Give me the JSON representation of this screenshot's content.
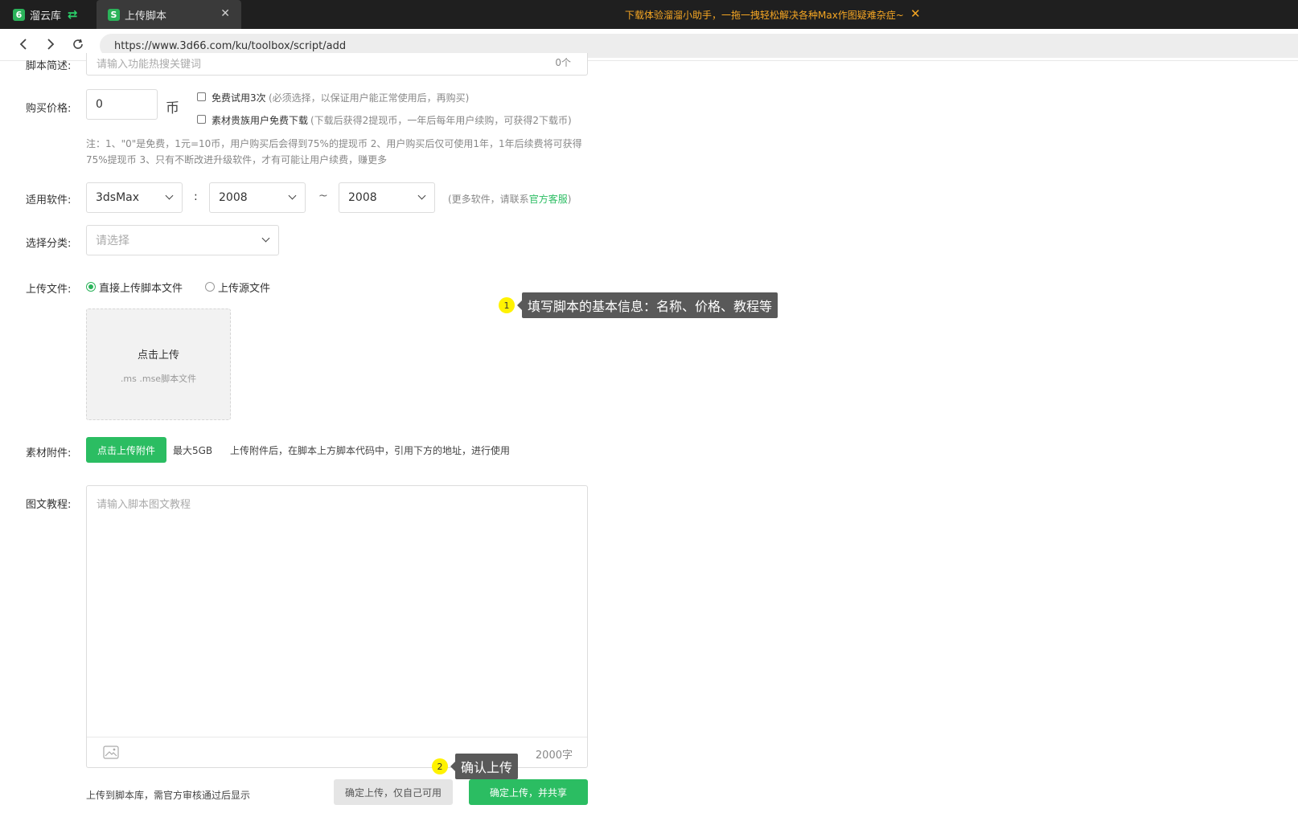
{
  "titlebar": {
    "home_tab": {
      "label": "溜云库",
      "logo": "6"
    },
    "active_tab": {
      "label": "上传脚本",
      "logo": "S"
    },
    "promo_text": "下载体验溜溜小助手，一拖一拽轻松解决各种Max作图疑难杂症~"
  },
  "nav": {
    "url": "https://www.3d66.com/ku/toolbox/script/add"
  },
  "form": {
    "desc": {
      "label": "脚本简述:",
      "placeholder": "请输入功能热搜关键词",
      "count": "0个"
    },
    "price": {
      "label": "购买价格:",
      "value": "0",
      "unit": "币",
      "free_trial": {
        "label": "免费试用3次",
        "note": "(必须选择，以保证用户能正常使用后，再购买)"
      },
      "vip_free": {
        "label": "素材贵族用户免费下载",
        "note": "(下载后获得2提现币，一年后每年用户续购，可获得2下载币)"
      },
      "note_line1": "注：1、\"0\"是免费，1元=10币，用户购买后会得到75%的提现币 2、用户购买后仅可使用1年，1年后续费将可获得",
      "note_line2": "75%提现币 3、只有不断改进升级软件，才有可能让用户续费，赚更多"
    },
    "software": {
      "label": "适用软件:",
      "product": "3dsMax",
      "sep1": ":",
      "from": "2008",
      "sep2": "~",
      "to": "2008",
      "hint_prefix": "(更多软件，请联系",
      "hint_link": "官方客服",
      "hint_suffix": ")"
    },
    "category": {
      "label": "选择分类:",
      "placeholder": "请选择"
    },
    "upload": {
      "label": "上传文件:",
      "option_direct": "直接上传脚本文件",
      "option_source": "上传源文件",
      "box_title": "点击上传",
      "box_hint": ".ms .mse脚本文件"
    },
    "attachment": {
      "label": "素材附件:",
      "button": "点击上传附件",
      "max": "最大5GB",
      "hint": "上传附件后，在脚本上方脚本代码中，引用下方的地址，进行使用"
    },
    "tutorial": {
      "label": "图文教程:",
      "placeholder": "请输入脚本图文教程",
      "limit": "2000字"
    },
    "footer": {
      "notice": "上传到脚本库，需官方审核通过后显示",
      "private_button": "确定上传，仅自己可用",
      "share_button": "确定上传，并共享"
    }
  },
  "callouts": {
    "one": {
      "num": "1",
      "text": "填写脚本的基本信息：名称、价格、教程等"
    },
    "two": {
      "num": "2",
      "text": "确认上传"
    }
  },
  "colors": {
    "accent": "#2bbd62",
    "promo": "#f5a623",
    "callout_badge": "#fff200",
    "callout_bg": "#595959"
  }
}
